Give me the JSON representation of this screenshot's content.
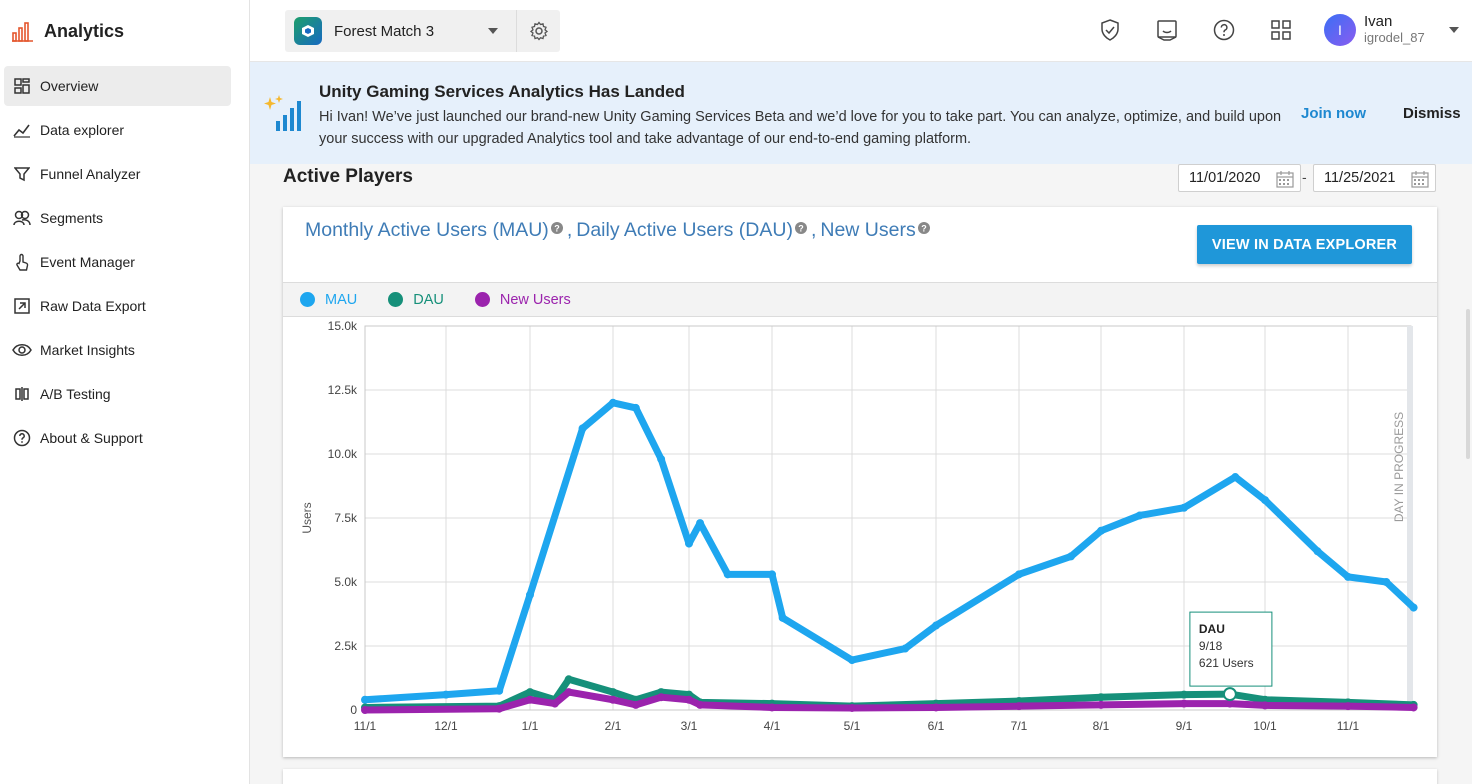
{
  "app": {
    "title": "Analytics"
  },
  "sidebar": {
    "items": [
      {
        "label": "Overview",
        "icon": "overview-icon",
        "active": true
      },
      {
        "label": "Data explorer",
        "icon": "line-chart-icon"
      },
      {
        "label": "Funnel Analyzer",
        "icon": "funnel-icon"
      },
      {
        "label": "Segments",
        "icon": "segments-icon"
      },
      {
        "label": "Event Manager",
        "icon": "touch-icon"
      },
      {
        "label": "Raw Data Export",
        "icon": "export-icon"
      },
      {
        "label": "Market Insights",
        "icon": "eye-icon"
      },
      {
        "label": "A/B Testing",
        "icon": "ab-testing-icon"
      },
      {
        "label": "About & Support",
        "icon": "help-icon"
      }
    ]
  },
  "header": {
    "project_name": "Forest Match 3",
    "user": {
      "name": "Ivan",
      "handle": "igrodel_87",
      "initial": "I"
    }
  },
  "banner": {
    "title": "Unity Gaming Services Analytics Has Landed",
    "text": "Hi Ivan! We’ve just launched our brand-new Unity Gaming Services Beta and we’d love for you to take part. You can analyze, optimize, and build upon your success with our upgraded Analytics tool and take advantage of our end-to-end gaming platform.",
    "join_label": "Join now",
    "dismiss_label": "Dismiss"
  },
  "section": {
    "title": "Active Players",
    "date_from": "11/01/2020",
    "date_to": "11/25/2021",
    "date_sep": "-"
  },
  "card": {
    "title_mau": "Monthly Active Users (MAU)",
    "title_dau": "Daily Active Users (DAU)",
    "title_new": "New Users",
    "title_sep": ",",
    "button_label": "VIEW IN DATA EXPLORER"
  },
  "colors": {
    "mau": "#1ea6ef",
    "dau": "#16907a",
    "new_users": "#9b23ad",
    "accent": "#1f97d9"
  },
  "chart_data": {
    "type": "line",
    "ylabel": "Users",
    "ylim": [
      0,
      15000
    ],
    "y_ticks": [
      "0",
      "2.5k",
      "5.0k",
      "7.5k",
      "10.0k",
      "12.5k",
      "15.0k"
    ],
    "x_ticks": [
      "11/1",
      "12/1",
      "1/1",
      "2/1",
      "3/1",
      "4/1",
      "5/1",
      "6/1",
      "7/1",
      "8/1",
      "9/1",
      "10/1",
      "11/1"
    ],
    "annotation": "DAY IN PROGRESS",
    "series": [
      {
        "name": "MAU",
        "x": [
          "11/1",
          "12/1",
          "12/20",
          "1/1",
          "1/20",
          "2/1",
          "2/10",
          "2/20",
          "3/1",
          "3/5",
          "3/15",
          "4/1",
          "4/5",
          "5/1",
          "5/20",
          "6/1",
          "7/1",
          "7/20",
          "8/1",
          "8/15",
          "9/1",
          "9/20",
          "10/1",
          "10/20",
          "11/1",
          "11/15",
          "11/25"
        ],
        "values": [
          400,
          600,
          750,
          4500,
          11000,
          12000,
          11800,
          9800,
          6500,
          7300,
          5300,
          5300,
          3600,
          1950,
          2400,
          3300,
          5300,
          6000,
          7000,
          7600,
          7900,
          9100,
          8200,
          6200,
          5200,
          5000,
          4000
        ]
      },
      {
        "name": "DAU",
        "x": [
          "11/1",
          "12/20",
          "1/1",
          "1/10",
          "1/15",
          "2/1",
          "2/10",
          "2/20",
          "3/1",
          "3/5",
          "4/1",
          "5/1",
          "6/1",
          "7/1",
          "8/1",
          "9/1",
          "9/18",
          "10/1",
          "11/1",
          "11/25"
        ],
        "values": [
          100,
          150,
          700,
          400,
          1200,
          700,
          400,
          700,
          600,
          300,
          250,
          150,
          250,
          350,
          500,
          600,
          621,
          400,
          300,
          200
        ]
      },
      {
        "name": "New Users",
        "x": [
          "11/1",
          "12/20",
          "1/1",
          "1/10",
          "1/15",
          "2/1",
          "2/10",
          "2/20",
          "3/1",
          "3/5",
          "4/1",
          "5/1",
          "6/1",
          "7/1",
          "8/1",
          "9/1",
          "9/18",
          "10/1",
          "11/1",
          "11/25"
        ],
        "values": [
          0,
          50,
          400,
          250,
          700,
          400,
          200,
          500,
          400,
          200,
          100,
          80,
          100,
          150,
          200,
          250,
          250,
          180,
          150,
          100
        ]
      }
    ],
    "tooltip": {
      "series": "DAU",
      "date": "9/18",
      "value": "621 Users"
    }
  }
}
